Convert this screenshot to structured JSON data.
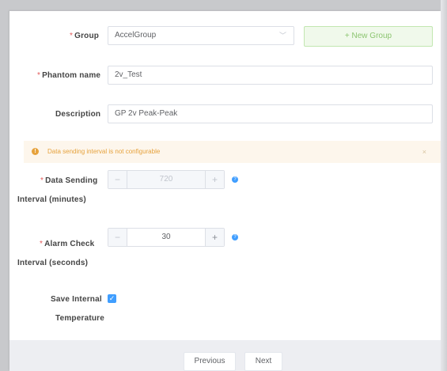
{
  "form": {
    "group": {
      "label": "Group",
      "required_mark": "*",
      "value": "AccelGroup",
      "dropdown_arrow": "chevron-down-icon",
      "new_group_label": "+ New Group"
    },
    "phantom_name": {
      "label": "Phantom name",
      "required_mark": "*",
      "value": "2v_Test"
    },
    "description": {
      "label": "Description",
      "value": "GP 2v Peak-Peak"
    },
    "alert": {
      "text": "Data sending interval is not configurable",
      "close": "×"
    },
    "data_sending": {
      "label_line1": "Data Sending",
      "label_line2": "Interval (minutes)",
      "required_mark": "*",
      "value": "720",
      "minus": "−",
      "plus": "+"
    },
    "alarm_check": {
      "label_line1": "Alarm Check",
      "label_line2": "Interval (seconds)",
      "required_mark": "*",
      "value": "30",
      "minus": "−",
      "plus": "+"
    },
    "save_temp": {
      "label_line1": "Save Internal",
      "label_line2": "Temperature",
      "checked": true
    }
  },
  "footer": {
    "previous_label": "Previous",
    "next_label": "Next"
  },
  "colors": {
    "primary": "#409eff",
    "success_bg": "#f0f9eb",
    "warning": "#e6a23c",
    "required": "#e35b5b"
  }
}
